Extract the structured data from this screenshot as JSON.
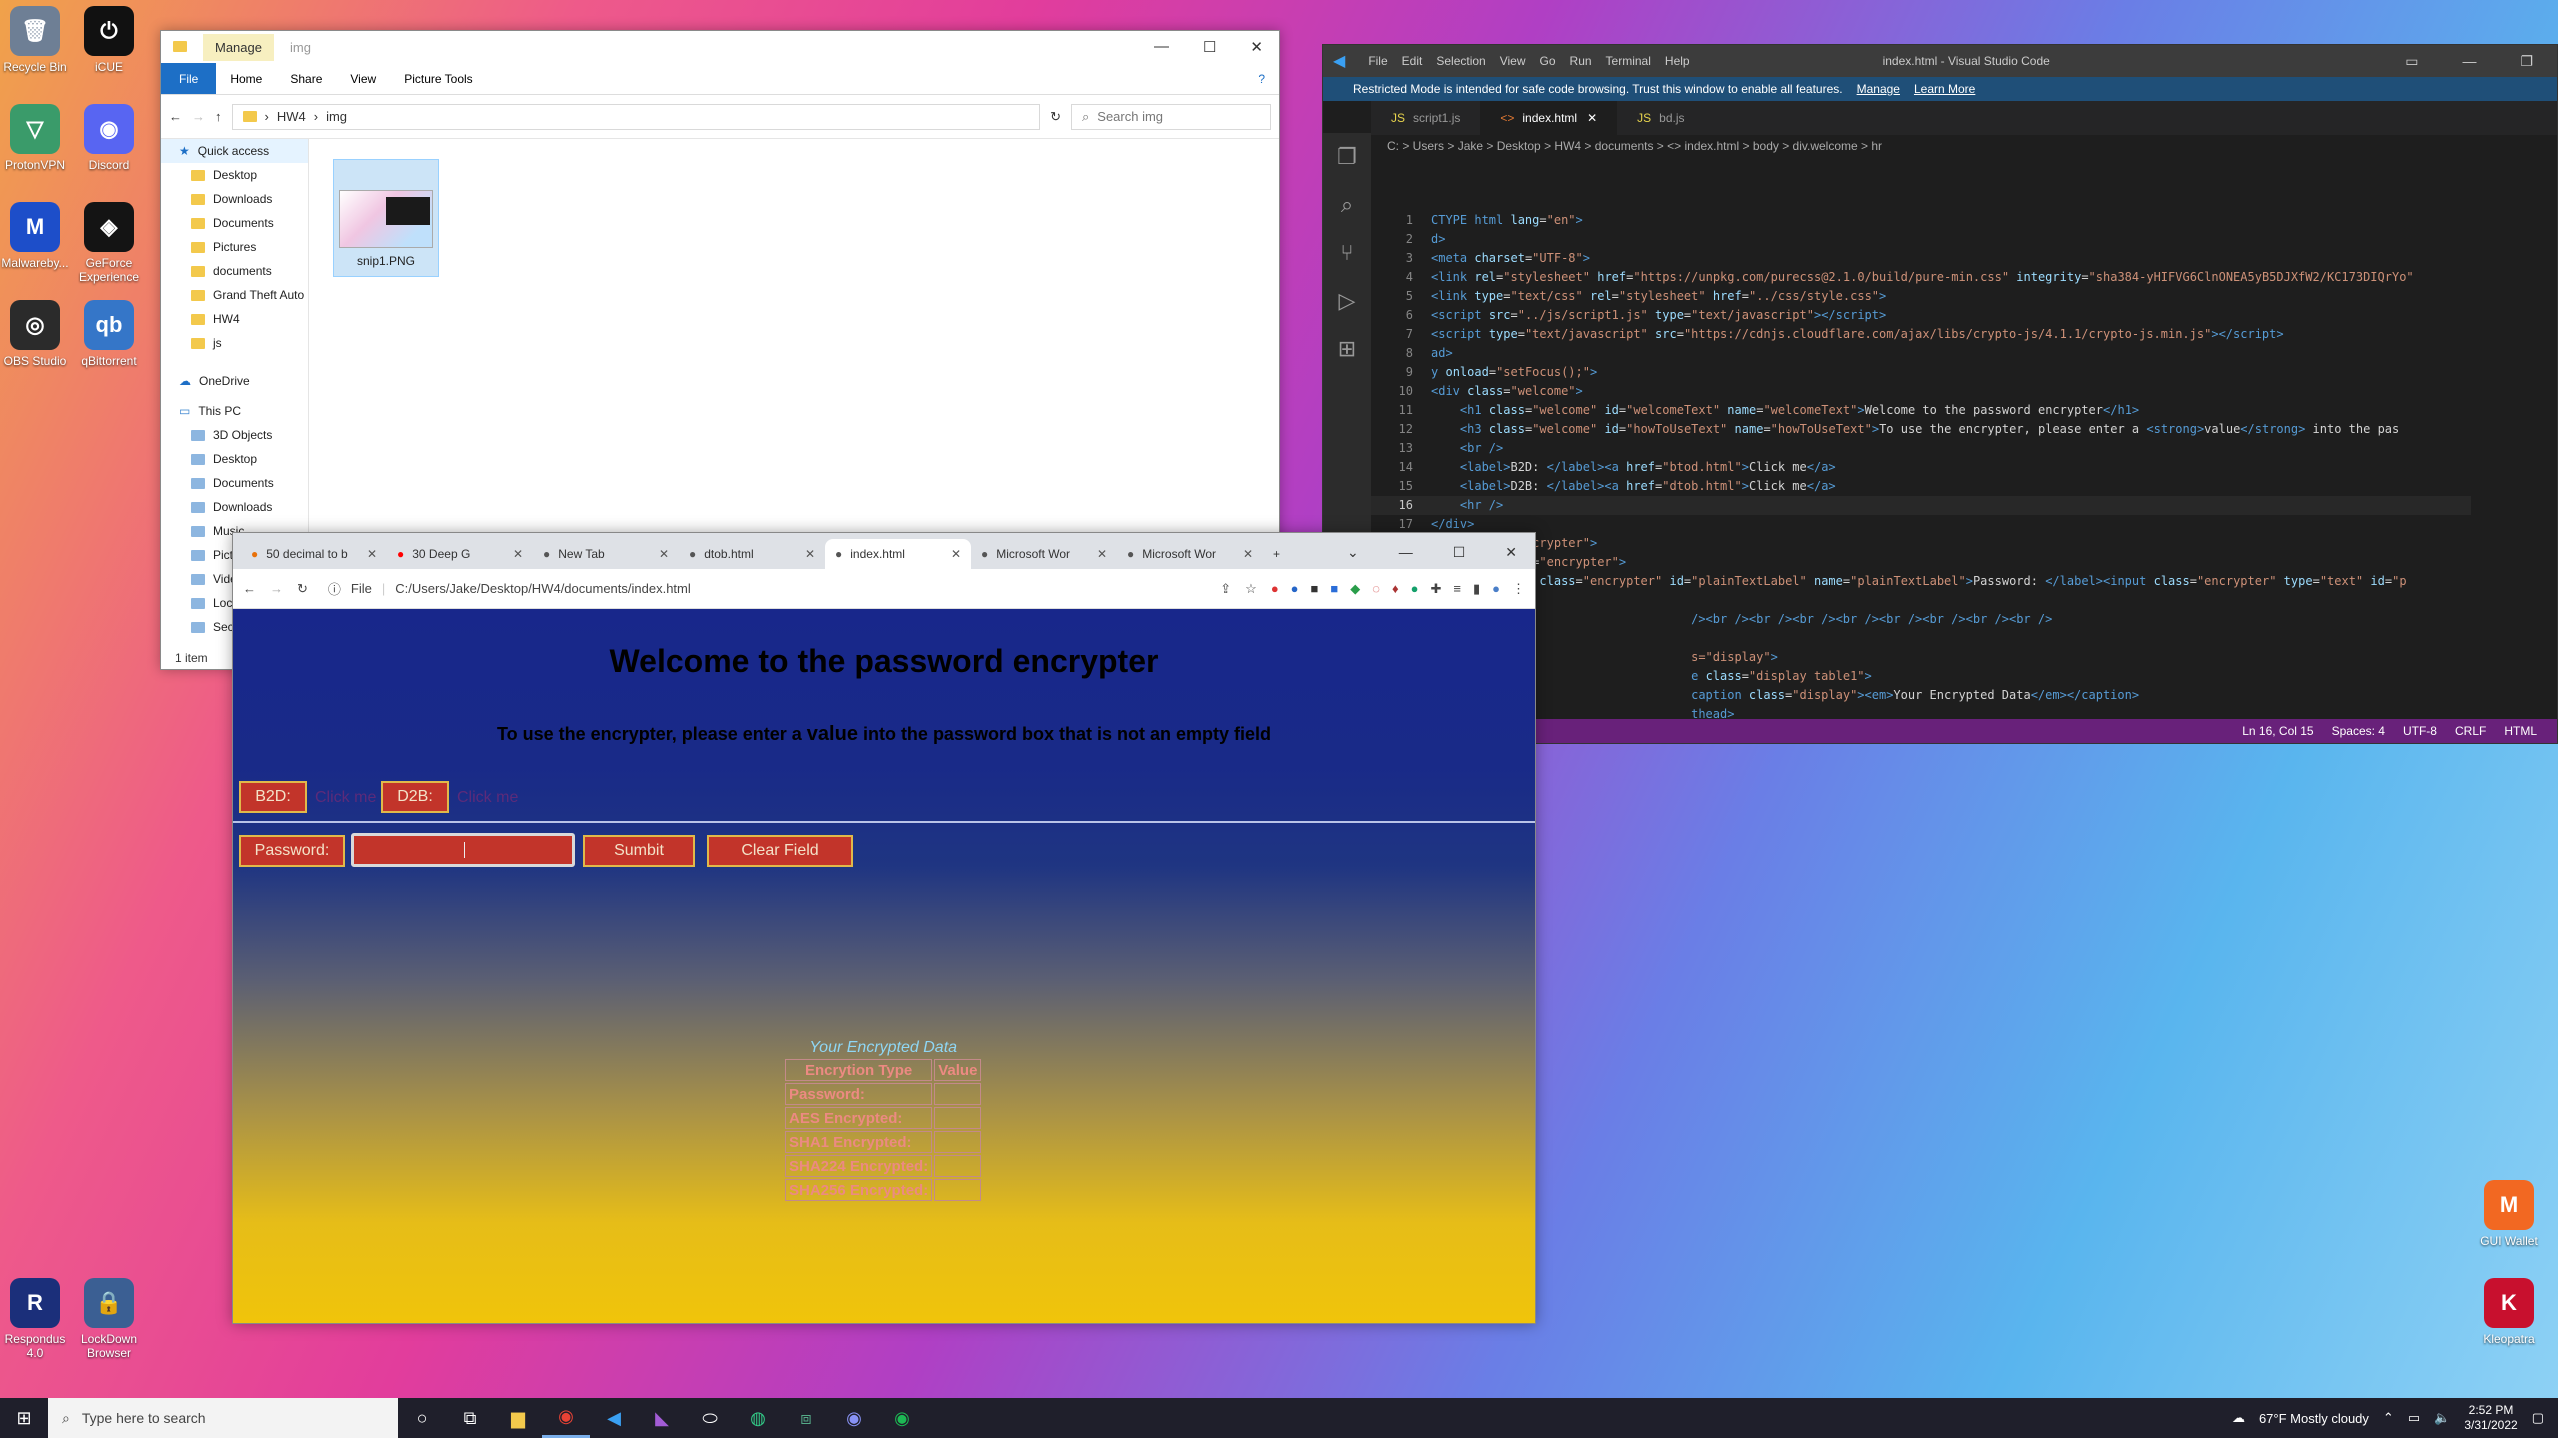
{
  "desktop": {
    "icons_left": [
      {
        "label": "Recycle Bin",
        "color": "#6e7f95",
        "glyph": "🗑"
      },
      {
        "label": "iCUE",
        "color": "#111111",
        "glyph": "⏻"
      },
      {
        "label": "ProtonVPN",
        "color": "#3a9b6a",
        "glyph": "▽"
      },
      {
        "label": "Discord",
        "color": "#5865f2",
        "glyph": "◉"
      },
      {
        "label": "Malwareby...",
        "color": "#1d4ec9",
        "glyph": "M"
      },
      {
        "label": "GeForce Experience",
        "color": "#141414",
        "glyph": "◈"
      },
      {
        "label": "OBS Studio",
        "color": "#2b2b2b",
        "glyph": "◎"
      },
      {
        "label": "qBittorrent",
        "color": "#3576c8",
        "glyph": "qb"
      }
    ],
    "icons_bottom_left": [
      {
        "label": "Respondus 4.0",
        "color": "#1b2f7a",
        "glyph": "R"
      },
      {
        "label": "LockDown Browser",
        "color": "#3b5f93",
        "glyph": "🔒"
      }
    ],
    "icons_right": [
      {
        "label": "GUI Wallet",
        "color": "#f26822",
        "glyph": "M"
      },
      {
        "label": "Kleopatra",
        "color": "#c8102e",
        "glyph": "K"
      }
    ]
  },
  "explorer": {
    "manage_label": "Manage",
    "title": "img",
    "ribbon": [
      "File",
      "Home",
      "Share",
      "View",
      "Picture Tools"
    ],
    "path": [
      "HW4",
      "img"
    ],
    "search_placeholder": "Search img",
    "nav": {
      "quick_access": "Quick access",
      "items": [
        "Desktop",
        "Downloads",
        "Documents",
        "Pictures",
        "documents",
        "Grand Theft Auto",
        "HW4",
        "js"
      ],
      "onedrive": "OneDrive",
      "this_pc": "This PC",
      "pc_items": [
        "3D Objects",
        "Desktop",
        "Documents",
        "Downloads",
        "Music",
        "Pictures",
        "Videos",
        "Local Disk",
        "Security"
      ]
    },
    "file": {
      "name": "snip1.PNG"
    },
    "status": "1 item"
  },
  "vscode": {
    "menu": [
      "File",
      "Edit",
      "Selection",
      "View",
      "Go",
      "Run",
      "Terminal",
      "Help"
    ],
    "title": "index.html - Visual Studio Code",
    "banner": {
      "text": "Restricted Mode is intended for safe code browsing. Trust this window to enable all features.",
      "manage": "Manage",
      "learn": "Learn More"
    },
    "tabs": [
      {
        "label": "script1.js",
        "active": false
      },
      {
        "label": "index.html",
        "active": true
      },
      {
        "label": "bd.js",
        "active": false
      }
    ],
    "breadcrumb": "C: > Users > Jake > Desktop > HW4 > documents > <> index.html > body > div.welcome > hr",
    "status": {
      "position": "Ln 16, Col 15",
      "spaces": "Spaces: 4",
      "encoding": "UTF-8",
      "eol": "CRLF",
      "lang": "HTML"
    }
  },
  "chrome": {
    "tabs": [
      {
        "label": "50 decimal to b",
        "active": false
      },
      {
        "label": "30 Deep G",
        "active": false
      },
      {
        "label": "New Tab",
        "active": false
      },
      {
        "label": "dtob.html",
        "active": false
      },
      {
        "label": "index.html",
        "active": true
      },
      {
        "label": "Microsoft Wor",
        "active": false
      },
      {
        "label": "Microsoft Wor",
        "active": false
      }
    ],
    "url_prefix": "File",
    "url": "C:/Users/Jake/Desktop/HW4/documents/index.html",
    "page": {
      "title": "Welcome to the password encrypter",
      "instructions_before": "To use the encrypter, please enter a ",
      "instructions_strong": "value",
      "instructions_after": " into the password box that is not an empty field",
      "b2d_label": "B2D:",
      "b2d_link": "Click me",
      "d2b_label": "D2B:",
      "d2b_link": "Click me",
      "password_label": "Password:",
      "password_value": "",
      "submit_label": "Sumbit",
      "clear_label": "Clear Field",
      "table": {
        "caption": "Your Encrypted Data",
        "headers": [
          "Encrytion Type",
          "Value"
        ],
        "rows": [
          "Password:",
          "AES Encrypted:",
          "SHA1 Encrypted:",
          "SHA224 Encrypted:",
          "SHA256 Encrypted:"
        ]
      }
    }
  },
  "taskbar": {
    "search_placeholder": "Type here to search",
    "weather": "67°F  Mostly cloudy",
    "time": "2:52 PM",
    "date": "3/31/2022"
  }
}
